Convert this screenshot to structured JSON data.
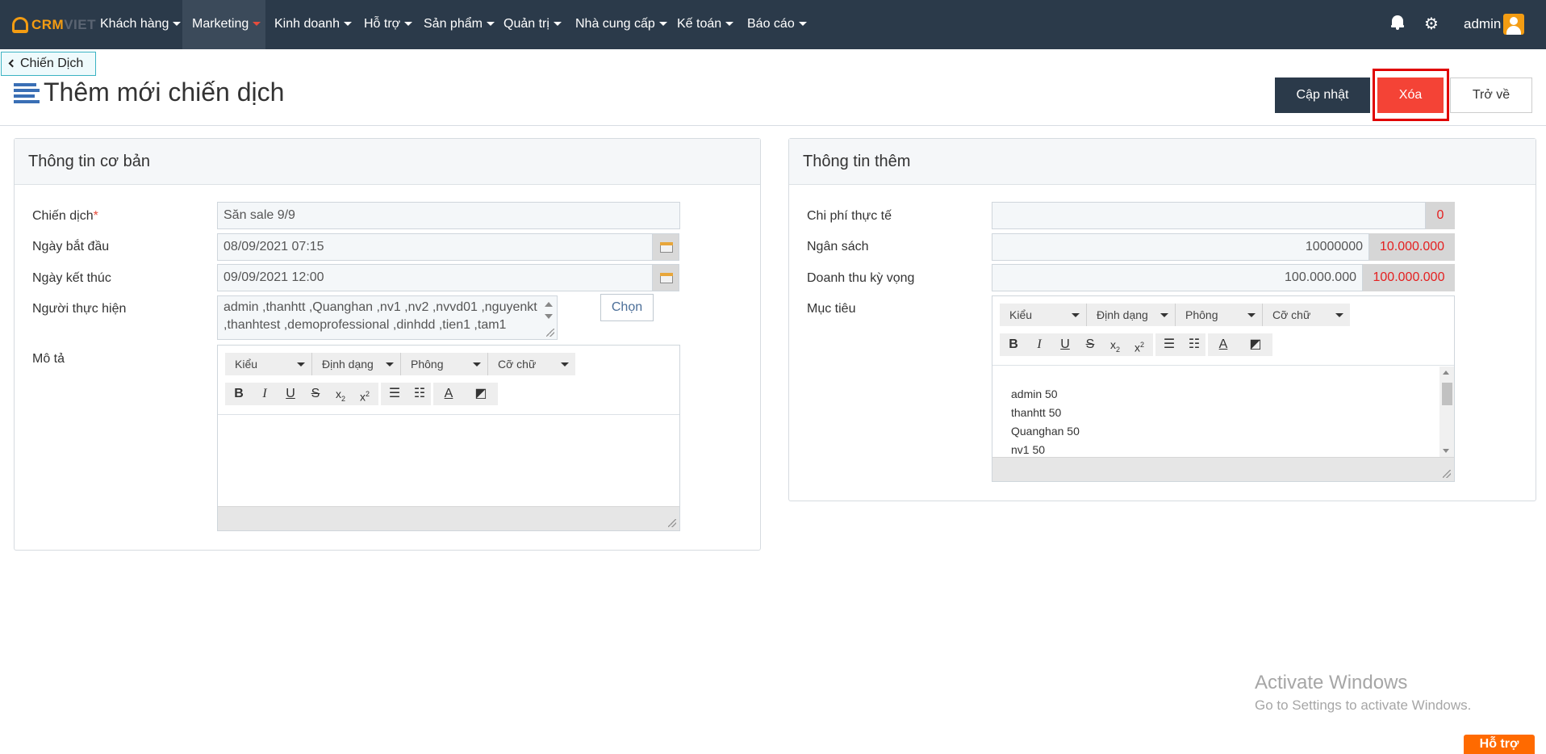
{
  "brand": {
    "crm": "CRM",
    "viet": "VIET"
  },
  "nav": {
    "items": [
      {
        "label": "Khách hàng"
      },
      {
        "label": "Marketing"
      },
      {
        "label": "Kinh doanh"
      },
      {
        "label": "Hỗ trợ"
      },
      {
        "label": "Sản phẩm"
      },
      {
        "label": "Quản trị"
      },
      {
        "label": "Nhà cung cấp"
      },
      {
        "label": "Kế toán"
      },
      {
        "label": "Báo cáo"
      }
    ],
    "active": "Marketing",
    "user": "admin"
  },
  "breadcrumb": {
    "back_label": "Chiến Dịch"
  },
  "page": {
    "title": "Thêm mới chiến dịch"
  },
  "actions": {
    "update": "Cập nhật",
    "delete": "Xóa",
    "back": "Trở về"
  },
  "basic": {
    "title": "Thông tin cơ bản",
    "campaign_label": "Chiến dịch",
    "required_mark": "*",
    "campaign_value": "Săn sale 9/9",
    "start_label": "Ngày bắt đầu",
    "start_value": "08/09/2021 07:15",
    "end_label": "Ngày kết thúc",
    "end_value": "09/09/2021 12:00",
    "assignee_label": "Người thực hiện",
    "assignee_line1": "admin ,thanhtt ,Quanghan ,nv1 ,nv2 ,nvvd01 ,nguyenkt",
    "assignee_line2": ",thanhtest ,demoprofessional ,dinhdd ,tien1 ,tam1",
    "choose_label": "Chọn",
    "description_label": "Mô tả"
  },
  "editor": {
    "style": "Kiểu",
    "format": "Định dạng",
    "font": "Phông",
    "size": "Cỡ chữ"
  },
  "extra": {
    "title": "Thông tin thêm",
    "actual_cost_label": "Chi phí thực tế",
    "actual_cost_value": "",
    "actual_cost_display": "0",
    "budget_label": "Ngân sách",
    "budget_value": "10000000",
    "budget_display": "10.000.000",
    "revenue_label": "Doanh thu kỳ vọng",
    "revenue_value": "100.000.000",
    "revenue_display": "100.000.000",
    "goal_label": "Mục tiêu",
    "goal_lines": [
      "admin 50",
      "thanhtt 50",
      "Quanghan 50",
      "nv1 50"
    ]
  },
  "windows": {
    "line1": "Activate Windows",
    "line2": "Go to Settings to activate Windows."
  },
  "support_label": "Hỗ trợ",
  "colors": {
    "navbar": "#2b3a4a",
    "accent": "#f39c12",
    "danger": "#f44336"
  }
}
